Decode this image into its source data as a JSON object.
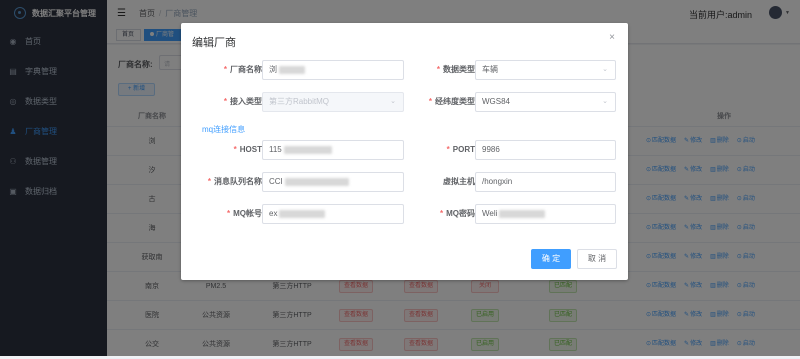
{
  "app": {
    "title": "数据汇聚平台管理"
  },
  "sidebar": {
    "items": [
      {
        "label": "首页",
        "icon": "dashboard-icon",
        "active": false
      },
      {
        "label": "字典管理",
        "icon": "document-icon",
        "active": false
      },
      {
        "label": "数据类型",
        "icon": "target-icon",
        "active": false
      },
      {
        "label": "厂商管理",
        "icon": "user-icon",
        "active": true
      },
      {
        "label": "数据管理",
        "icon": "tree-icon",
        "active": false
      },
      {
        "label": "数据归档",
        "icon": "archive-icon",
        "active": false
      }
    ]
  },
  "header": {
    "breadcrumb_home": "首页",
    "breadcrumb_sep": "/",
    "breadcrumb_current": "厂商管理",
    "user_text": "当前用户:admin"
  },
  "tags": {
    "home": "首页",
    "current": "厂商管"
  },
  "page": {
    "filter_label": "厂商名称:",
    "filter_placeholder": "请",
    "add_button": "+ 新增",
    "col_name": "厂商名称",
    "col_token": "oken",
    "col_ops": "操作"
  },
  "table": {
    "rows": [
      {
        "name": "浏",
        "type": "",
        "access": "",
        "p1": "",
        "p2": "",
        "p3": "",
        "p4": ""
      },
      {
        "name": "汐",
        "type": "",
        "access": "",
        "p1": "",
        "p2": "",
        "p3": "",
        "p4": ""
      },
      {
        "name": "古",
        "type": "",
        "access": "",
        "p1": "",
        "p2": "",
        "p3": "",
        "p4": ""
      },
      {
        "name": "海",
        "type": "",
        "access": "",
        "p1": "",
        "p2": "",
        "p3": "",
        "p4": ""
      },
      {
        "name": "获取南",
        "type": "",
        "access": "",
        "p1": "",
        "p2": "",
        "p3": "",
        "p4": ""
      },
      {
        "name": "南京",
        "type": "PM2.5",
        "access": "第三方HTTP",
        "p1": "查看数据",
        "p2": "查看数据",
        "p3": "关闭",
        "p4": "已匹配"
      },
      {
        "name": "医院",
        "type": "公共资源",
        "access": "第三方HTTP",
        "p1": "查看数据",
        "p2": "查看数据",
        "p3": "已启用",
        "p4": "已匹配"
      },
      {
        "name": "公交",
        "type": "公共资源",
        "access": "第三方HTTP",
        "p1": "查看数据",
        "p2": "查看数据",
        "p3": "已启用",
        "p4": "已匹配"
      }
    ],
    "ops": [
      "匹配数据",
      "修改",
      "删除",
      "启动"
    ]
  },
  "dialog": {
    "title": "编辑厂商",
    "close_glyph": "×",
    "section_title": "mq连接信息",
    "fields": {
      "vendor_name_label": "厂商名称",
      "vendor_name_value": "浏",
      "data_type_label": "数据类型",
      "data_type_value": "车辆",
      "access_type_label": "接入类型",
      "access_type_value": "第三方RabbitMQ",
      "coord_system_label": "经纬度类型",
      "coord_system_value": "WGS84",
      "host_label": "HOST",
      "host_value": "115",
      "port_label": "PORT",
      "port_value": "9986",
      "queue_label": "消息队列名称",
      "queue_value": "CCI",
      "vhost_label": "虚拟主机",
      "vhost_value": "/hongxin",
      "mq_account_label": "MQ帐号",
      "mq_account_value": "ex",
      "mq_password_label": "MQ密码",
      "mq_password_value": "Weli"
    },
    "ok_button": "确 定",
    "cancel_button": "取 消"
  },
  "colors": {
    "primary": "#409eff",
    "sidebar_bg": "#2c3241",
    "danger": "#f56c6c",
    "success": "#67c23a"
  }
}
